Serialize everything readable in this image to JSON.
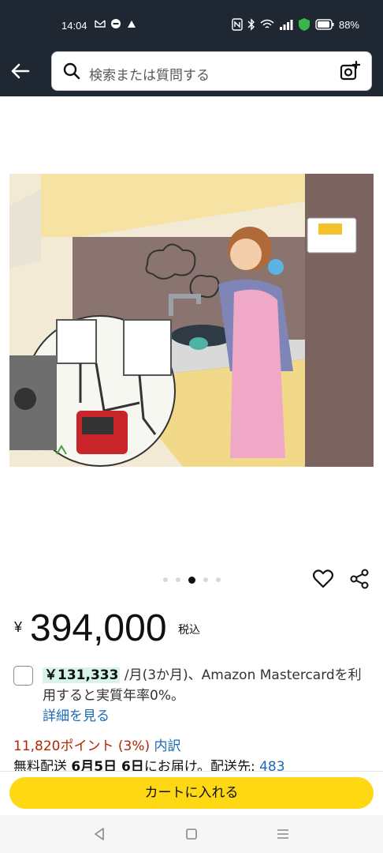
{
  "status_bar": {
    "time": "14:04",
    "battery": "88%"
  },
  "header": {
    "search_placeholder": "検索または質問する"
  },
  "product": {
    "price_symbol": "¥",
    "price": "394,000",
    "tax_label": "税込",
    "carousel": {
      "count": 5,
      "active_index": 2
    }
  },
  "installment": {
    "amount": "￥131,333",
    "text": " /月(3か月)、Amazon Mastercardを利用すると実質年率0%。",
    "link": "詳細を見る"
  },
  "points": {
    "text": "11,820ポイント (3%) ",
    "link": "内訳"
  },
  "delivery": {
    "prefix": "無料配送 ",
    "date": "6月5日 6日",
    "middle": "にお届け。配送先: ",
    "link": "483"
  },
  "cart": {
    "button_label": "カートに入れる"
  },
  "colors": {
    "header_bg": "#1f2733",
    "cart_yellow": "#ffd814",
    "link_blue": "#1b6bb5",
    "points_red": "#b12704"
  }
}
